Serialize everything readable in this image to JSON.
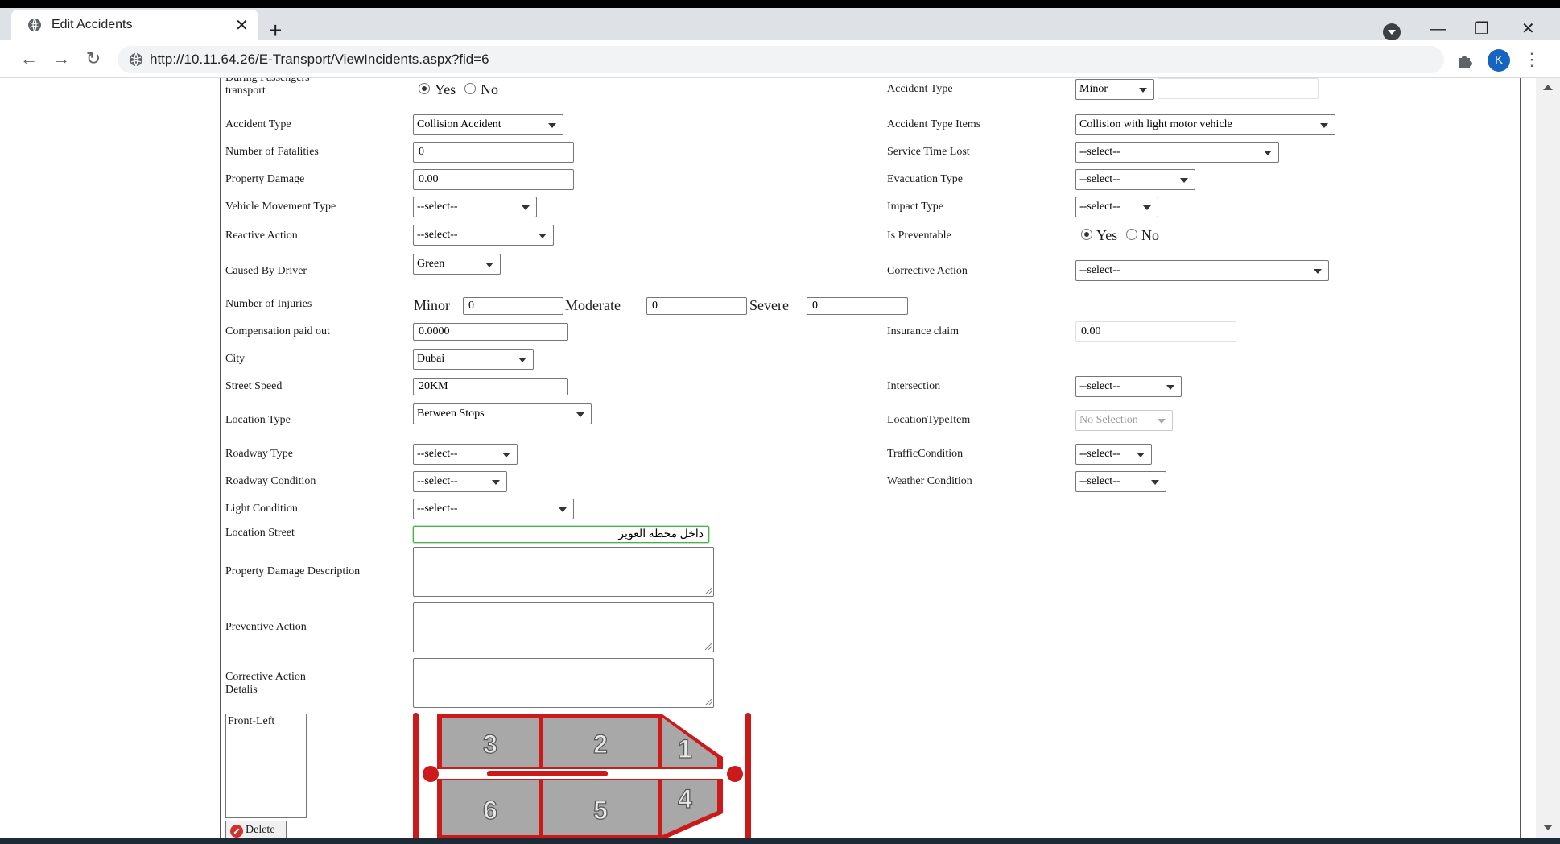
{
  "browser": {
    "tab_title": "Edit Accidents",
    "tab_close": "✕",
    "new_tab": "+",
    "minimize": "—",
    "restore": "❐",
    "close": "✕",
    "back": "←",
    "forward": "→",
    "reload": "↻",
    "url": "http://10.11.64.26/E-Transport/ViewIncidents.aspx?fid=6",
    "profile_initial": "K",
    "menu": "⋮"
  },
  "form": {
    "during_passengers_label": "During Passengers transport",
    "yes": "Yes",
    "no": "No",
    "accident_type_label": "Accident Type",
    "accident_type_value": "Collision Accident",
    "accident_severity_label": "Accident Type",
    "accident_severity_value": "Minor",
    "accident_type_items_label": "Accident Type Items",
    "accident_type_items_value": "Collision with light motor vehicle",
    "fatalities_label": "Number of Fatalities",
    "fatalities_value": "0",
    "service_time_lost_label": "Service Time Lost",
    "property_damage_label": "Property Damage",
    "property_damage_value": "0.00",
    "evacuation_type_label": "Evacuation Type",
    "vehicle_movement_label": "Vehicle Movement Type",
    "impact_type_label": "Impact Type",
    "reactive_action_label": "Reactive Action",
    "is_preventable_label": "Is Preventable",
    "caused_by_driver_label": "Caused By Driver",
    "caused_by_driver_value": "Green",
    "corrective_action_label": "Corrective Action",
    "injuries_label": "Number of Injuries",
    "minor_label": "Minor",
    "minor_value": "0",
    "moderate_label": "Moderate",
    "moderate_value": "0",
    "severe_label": "Severe",
    "severe_value": "0",
    "compensation_label": "Compensation paid out",
    "compensation_value": "0.0000",
    "insurance_label": "Insurance claim",
    "insurance_value": "0.00",
    "city_label": "City",
    "city_value": "Dubai",
    "street_speed_label": "Street Speed",
    "street_speed_value": "20KM",
    "intersection_label": "Intersection",
    "location_type_label": "Location Type",
    "location_type_value": "Between Stops",
    "location_type_item_label": "LocationTypeItem",
    "location_type_item_value": "No Selection",
    "roadway_type_label": "Roadway Type",
    "traffic_condition_label": "TrafficCondition",
    "roadway_condition_label": "Roadway Condition",
    "weather_condition_label": "Weather Condition",
    "light_condition_label": "Light Condition",
    "location_street_label": "Location Street",
    "location_street_value": "داخل محطة العوير",
    "property_damage_desc_label": "Property Damage Description",
    "preventive_action_label": "Preventive Action",
    "corrective_action_details_label": "Corrective Action Detalis",
    "select_placeholder": "--select--",
    "damage_list_item": "Front-Left",
    "delete_label": "Delete"
  },
  "bus_diagram": {
    "zones": [
      "3",
      "2",
      "1",
      "6",
      "5",
      "4"
    ],
    "color": "#cc1a1a",
    "panel_color": "#a8a8a8"
  }
}
